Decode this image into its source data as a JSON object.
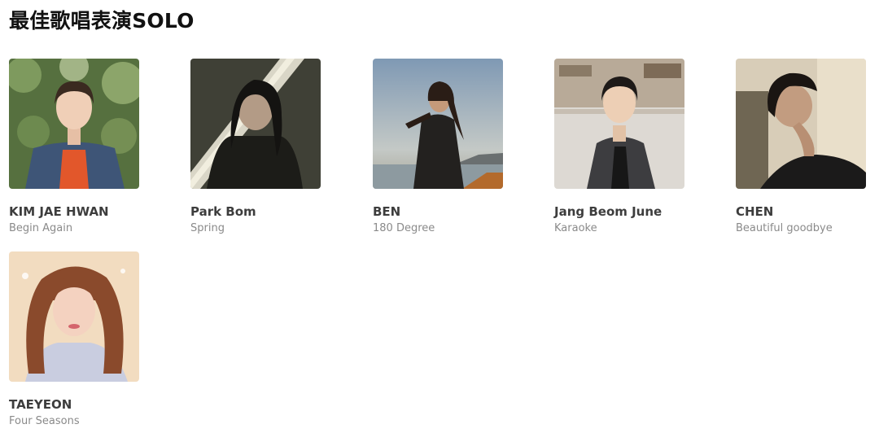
{
  "page": {
    "title": "最佳歌唱表演SOLO"
  },
  "nominees": [
    {
      "name": "KIM JAE HWAN",
      "song": "Begin Again"
    },
    {
      "name": "Park Bom",
      "song": "Spring"
    },
    {
      "name": "BEN",
      "song": "180 Degree"
    },
    {
      "name": "Jang Beom June",
      "song": "Karaoke"
    },
    {
      "name": "CHEN",
      "song": "Beautiful goodbye"
    },
    {
      "name": "TAEYEON",
      "song": "Four Seasons"
    }
  ]
}
